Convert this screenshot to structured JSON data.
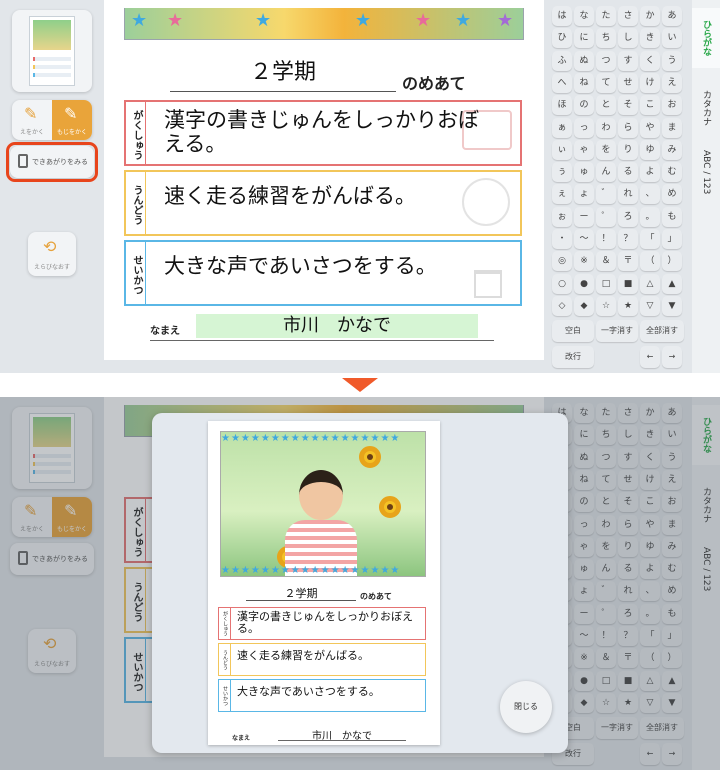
{
  "left_panel": {
    "mode_write": "えをかく",
    "mode_text": "もじをかく",
    "preview_label": "できあがりをみる",
    "redo_label": "えらびなおす"
  },
  "sheet": {
    "term": "２学期",
    "goal_suffix": "のめあて",
    "goals": [
      {
        "tag": "がくしゅう",
        "text": "漢字の書きじゅんをしっかりおぼえる。",
        "color": "#e57373"
      },
      {
        "tag": "うんどう",
        "text": "速く走る練習をがんばる。",
        "color": "#f2c65a"
      },
      {
        "tag": "せいかつ",
        "text": "大きな声であいさつをする。",
        "color": "#5ab7e6"
      }
    ],
    "name_label": "なまえ",
    "name_value": "市川　かなで"
  },
  "keyboard": {
    "rows": [
      [
        "は",
        "な",
        "た",
        "さ",
        "か",
        "あ"
      ],
      [
        "ひ",
        "に",
        "ち",
        "し",
        "き",
        "い"
      ],
      [
        "ふ",
        "ぬ",
        "つ",
        "す",
        "く",
        "う"
      ],
      [
        "へ",
        "ね",
        "て",
        "せ",
        "け",
        "え"
      ],
      [
        "ほ",
        "の",
        "と",
        "そ",
        "こ",
        "お"
      ],
      [
        "ぁ",
        "っ",
        "わ",
        "ら",
        "や",
        "ま"
      ],
      [
        "ぃ",
        "ゃ",
        "を",
        "り",
        "ゆ",
        "み"
      ],
      [
        "ぅ",
        "ゅ",
        "ん",
        "る",
        "よ",
        "む"
      ],
      [
        "ぇ",
        "ょ",
        "゛",
        "れ",
        "、",
        "め"
      ],
      [
        "ぉ",
        "ー",
        "゜",
        "ろ",
        "。",
        "も"
      ],
      [
        "・",
        "〜",
        "！",
        "？",
        "「",
        "」"
      ],
      [
        "◎",
        "※",
        "＆",
        "〒",
        "（",
        "）"
      ],
      [
        "○",
        "●",
        "□",
        "■",
        "△",
        "▲"
      ],
      [
        "◇",
        "◆",
        "☆",
        "★",
        "▽",
        "▼"
      ]
    ],
    "space_label": "空白",
    "delete_one_label": "一字消す",
    "delete_all_label": "全部消す",
    "newline_label": "改行",
    "left_arrow": "←",
    "right_arrow": "→"
  },
  "tabs": [
    "ひらがな",
    "カタカナ",
    "ABC / 123"
  ],
  "modal": {
    "close_label": "閉じる"
  }
}
